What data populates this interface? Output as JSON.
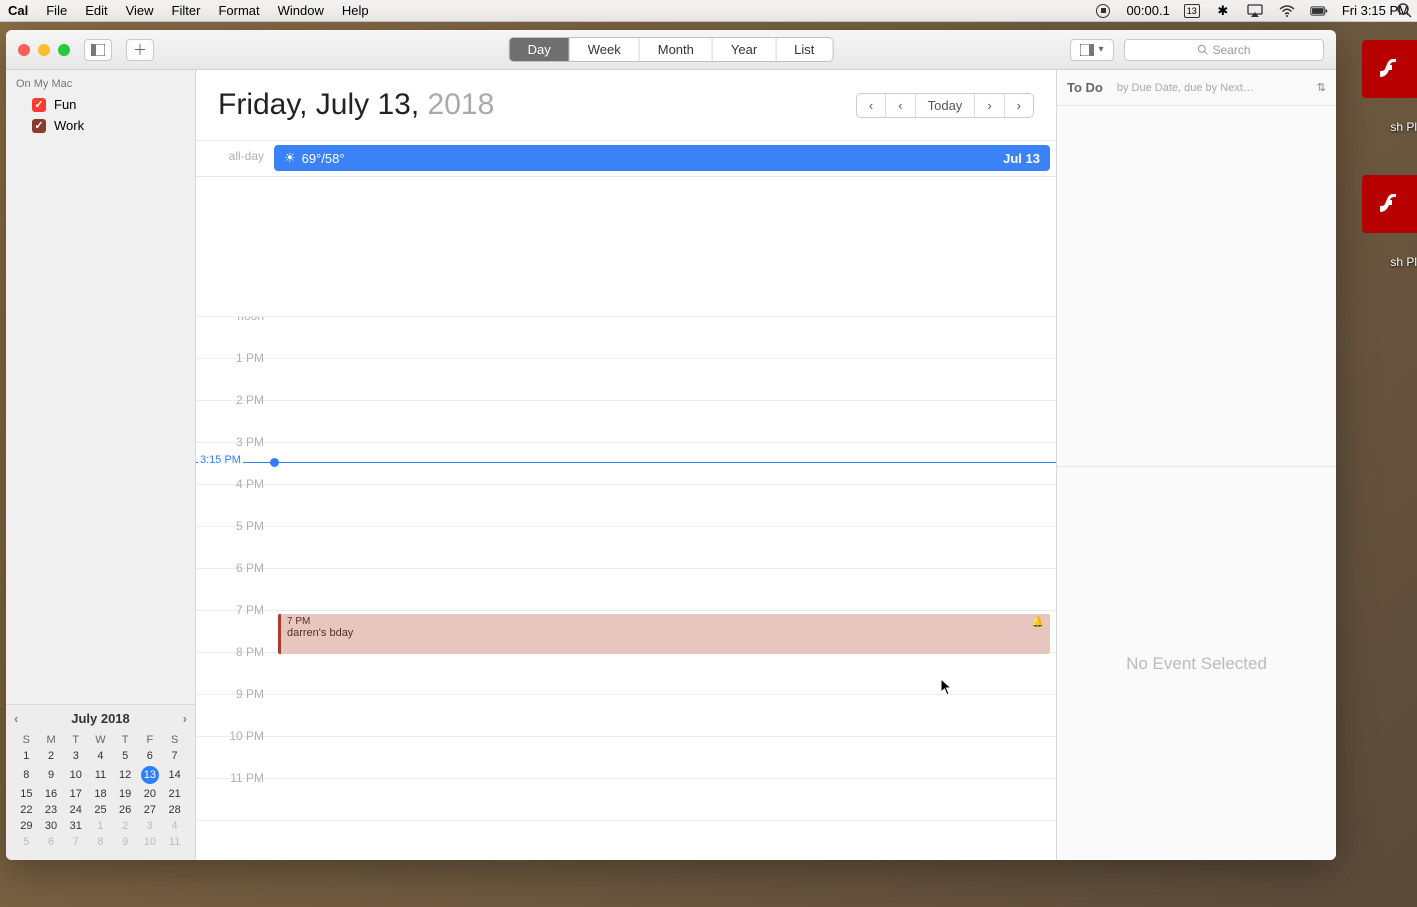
{
  "menubar": {
    "app": "Cal",
    "items": [
      "File",
      "Edit",
      "View",
      "Filter",
      "Format",
      "Window",
      "Help"
    ],
    "rec_time": "00:00.1",
    "date_badge": "13",
    "clock": "Fri 3:15 PM"
  },
  "titlebar": {
    "views": [
      "Day",
      "Week",
      "Month",
      "Year",
      "List"
    ],
    "selected_view": "Day",
    "search_placeholder": "Search"
  },
  "sidebar": {
    "section": "On My Mac",
    "calendars": [
      {
        "name": "Fun",
        "color": "#ff3b30",
        "checked": true
      },
      {
        "name": "Work",
        "color": "#8b3a2e",
        "checked": true
      }
    ]
  },
  "mini_cal": {
    "title": "July 2018",
    "dow": [
      "S",
      "M",
      "T",
      "W",
      "T",
      "F",
      "S"
    ],
    "rows": [
      [
        "1",
        "2",
        "3",
        "4",
        "5",
        "6",
        "7"
      ],
      [
        "8",
        "9",
        "10",
        "11",
        "12",
        "13",
        "14"
      ],
      [
        "15",
        "16",
        "17",
        "18",
        "19",
        "20",
        "21"
      ],
      [
        "22",
        "23",
        "24",
        "25",
        "26",
        "27",
        "28"
      ],
      [
        "29",
        "30",
        "31",
        "1",
        "2",
        "3",
        "4"
      ],
      [
        "5",
        "6",
        "7",
        "8",
        "9",
        "10",
        "11"
      ]
    ],
    "today": "13"
  },
  "main": {
    "title_strong": "Friday, July 13,",
    "title_dim": " 2018",
    "nav": {
      "today": "Today"
    },
    "allday_label": "all-day",
    "allday_event": {
      "temps": "69°/58°",
      "right": "Jul 13"
    },
    "now": "3:15 PM",
    "hours": [
      "noon",
      "1 PM",
      "2 PM",
      "3 PM",
      "4 PM",
      "5 PM",
      "6 PM",
      "7 PM",
      "8 PM",
      "9 PM",
      "10 PM",
      "11 PM"
    ],
    "event": {
      "time": "7 PM",
      "title": "darren's bday"
    }
  },
  "todo": {
    "title": "To Do",
    "sort": "by Due Date, due by Next…",
    "empty": "No Event Selected"
  },
  "desktop": {
    "flash_label": "sh Pl"
  }
}
